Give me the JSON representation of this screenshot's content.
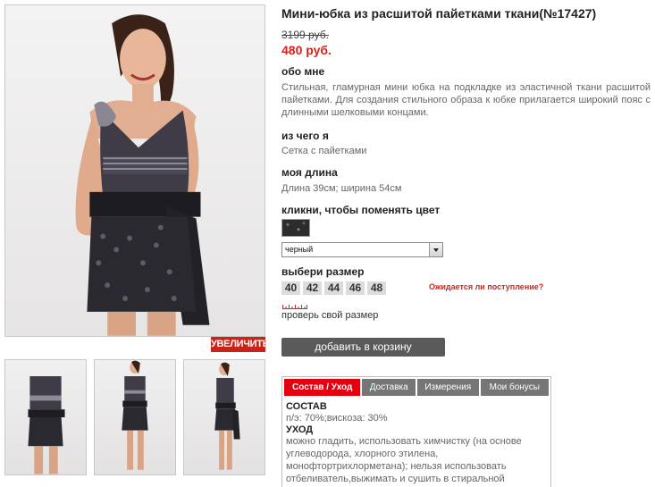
{
  "product": {
    "title": "Мини-юбка из расшитой пайетками ткани(№17427)",
    "old_price": "3199 руб.",
    "new_price": "480 руб."
  },
  "photos": {
    "zoom_label": "УВЕЛИЧИТЬ"
  },
  "about": {
    "heading": "обо мне",
    "text": "Стильная, гламурная мини юбка на подкладке из эластичной ткани расшитой пайетками. Для создания стильного образа к юбке прилагается широкий пояс с длинными шелковыми концами."
  },
  "material": {
    "heading": "из чего я",
    "text": "Сетка с пайетками"
  },
  "length": {
    "heading": "моя длина",
    "text": "Длина 39см; ширина 54см"
  },
  "color": {
    "heading": "кликни, чтобы поменять цвет",
    "selected": "черный"
  },
  "size": {
    "heading": "выбери размер",
    "options": [
      "40",
      "42",
      "44",
      "46",
      "48"
    ],
    "expect_link": "Ожидается ли поступление?",
    "check_link": "проверь свой размер"
  },
  "cart": {
    "add_label": "добавить в корзину"
  },
  "tabs": {
    "items": [
      "Состав / Уход",
      "Доставка",
      "Измерения",
      "Мои бонусы"
    ],
    "active_index": 0,
    "content": {
      "composition_heading": "СОСТАВ",
      "composition_text": "п/э: 70%;вискоза: 30%",
      "care_heading": "УХОД",
      "care_text": "можно гладить, использовать химчистку (на основе углеводорода, хлорного этилена, монофтортрихлорметана); нельзя использовать отбеливатель,выжимать и сушить в стиральной"
    }
  },
  "colors": {
    "accent_red": "#e3000f",
    "price_red": "#d8221c",
    "button_gray": "#5a5a5a"
  }
}
